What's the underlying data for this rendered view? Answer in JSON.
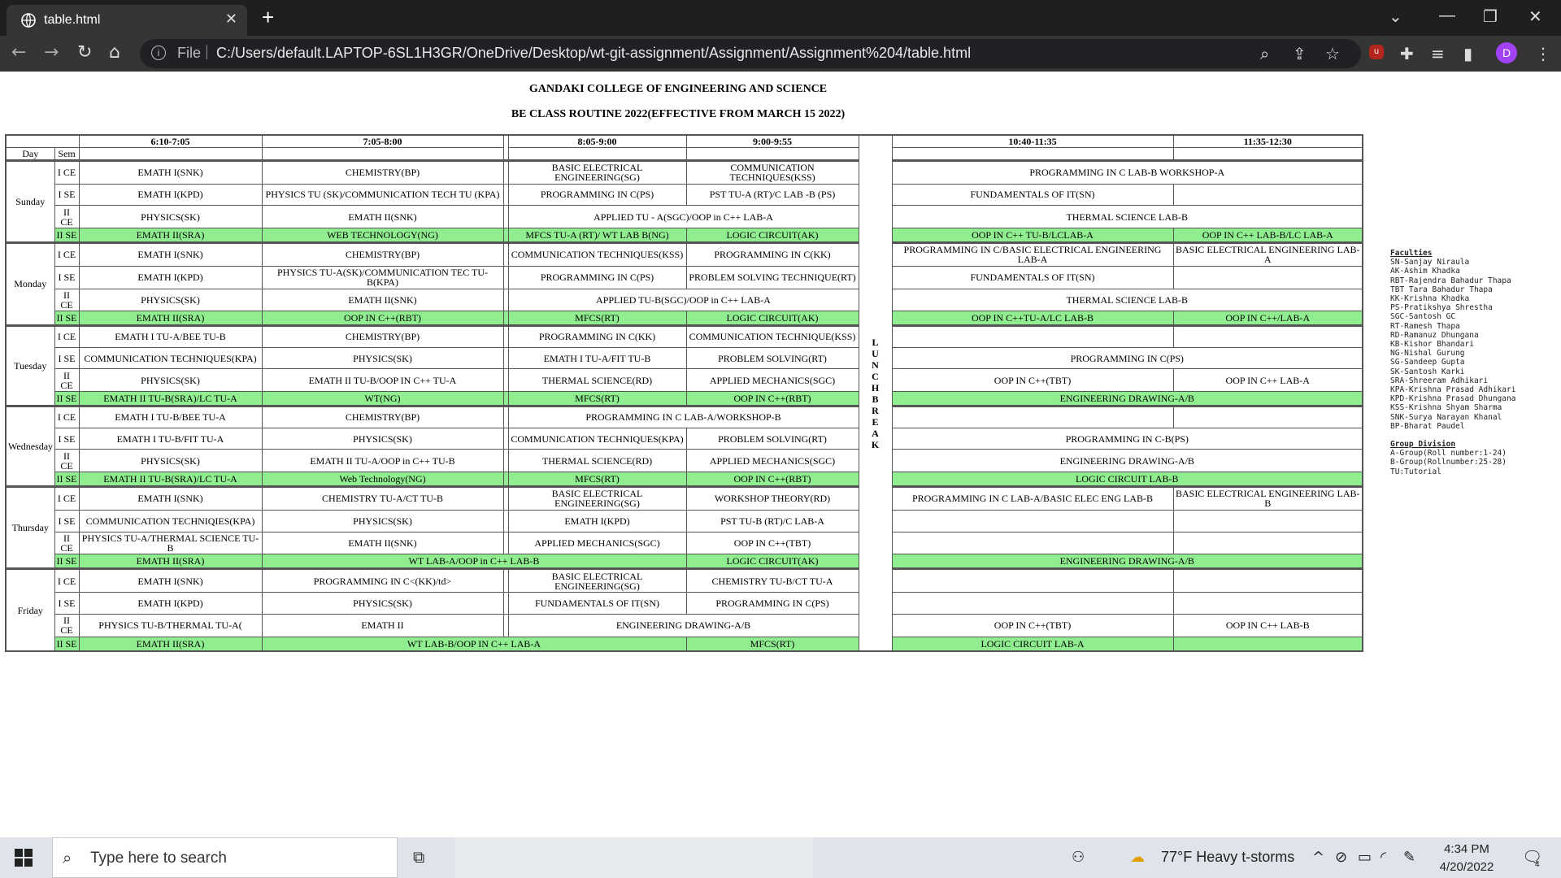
{
  "browser": {
    "tab_title": "table.html",
    "tab_close": "✕",
    "new_tab": "+",
    "file_label": "File",
    "url": "C:/Users/default.LAPTOP-6SL1H3GR/OneDrive/Desktop/wt-git-assignment/Assignment/Assignment%204/table.html",
    "profile_initial": "D"
  },
  "page": {
    "college": "GANDAKI COLLEGE OF ENGINEERING AND SCIENCE",
    "routine_title": "BE CLASS ROUTINE 2022(EFFECTIVE FROM MARCH 15 2022)",
    "table": {
      "times": [
        "6:10-7:05",
        "7:05-8:00",
        "8:05-9:00",
        "9:00-9:55",
        "10:40-11:35",
        "11:35-12:30"
      ],
      "day_header": "Day",
      "sem_header": "Sem",
      "lunch_letters": [
        "L",
        "U",
        "N",
        "C",
        "H",
        "B",
        "R",
        "E",
        "A",
        "K"
      ],
      "days": [
        {
          "name": "Sunday",
          "rows": [
            {
              "sem": "I CE",
              "cells": [
                {
                  "text": "EMATH I(SNK)"
                },
                {
                  "text": "CHEMISTRY(BP)"
                },
                {
                  "text": "BASIC ELECTRICAL ENGINEERING(SG)"
                },
                {
                  "text": "COMMUNICATION TECHNIQUES(KSS)"
                },
                {
                  "text": "PROGRAMMING IN C LAB-B WORKSHOP-A",
                  "span": 2
                }
              ]
            },
            {
              "sem": "I SE",
              "cells": [
                {
                  "text": "EMATH I(KPD)"
                },
                {
                  "text": "PHYSICS TU (SK)/COMMUNICATION TECH TU (KPA)"
                },
                {
                  "text": "PROGRAMMING IN C(PS)"
                },
                {
                  "text": "PST TU-A (RT)/C LAB -B (PS)"
                },
                {
                  "text": "FUNDAMENTALS OF IT(SN)"
                },
                {
                  "text": ""
                }
              ]
            },
            {
              "sem": "II CE",
              "cells": [
                {
                  "text": "PHYSICS(SK)"
                },
                {
                  "text": "EMATH II(SNK)"
                },
                {
                  "text": "APPLIED TU - A(SGC)/OOP in C++ LAB-A",
                  "span": 2
                },
                {
                  "text": "THERMAL SCIENCE LAB-B",
                  "span": 2
                }
              ]
            },
            {
              "sem": "II SE",
              "green": true,
              "cells": [
                {
                  "text": "EMATH II(SRA)"
                },
                {
                  "text": "WEB TECHNOLOGY(NG)"
                },
                {
                  "text": "MFCS TU-A (RT)/ WT LAB B(NG)"
                },
                {
                  "text": "LOGIC CIRCUIT(AK)"
                },
                {
                  "text": "OOP IN C++ TU-B/LCLAB-A"
                },
                {
                  "text": "OOP IN C++ LAB-B/LC LAB-A"
                }
              ]
            }
          ]
        },
        {
          "name": "Monday",
          "rows": [
            {
              "sem": "I CE",
              "cells": [
                {
                  "text": "EMATH I(SNK)"
                },
                {
                  "text": "CHEMISTRY(BP)"
                },
                {
                  "text": "COMMUNICATION TECHNIQUES(KSS)"
                },
                {
                  "text": "PROGRAMMING IN C(KK)"
                },
                {
                  "text": "PROGRAMMING IN C/BASIC ELECTRICAL ENGINEERING LAB-A"
                },
                {
                  "text": "BASIC ELECTRICAL ENGINEERING LAB-A"
                }
              ]
            },
            {
              "sem": "I SE",
              "cells": [
                {
                  "text": "EMATH I(KPD)"
                },
                {
                  "text": "PHYSICS TU-A(SK)/COMMUNICATION TEC TU-B(KPA)"
                },
                {
                  "text": "PROGRAMMING IN C(PS)"
                },
                {
                  "text": "PROBLEM SOLVING TECHNIQUE(RT)"
                },
                {
                  "text": "FUNDAMENTALS OF IT(SN)"
                },
                {
                  "text": ""
                }
              ]
            },
            {
              "sem": "II CE",
              "cells": [
                {
                  "text": "PHYSICS(SK)"
                },
                {
                  "text": "EMATH II(SNK)"
                },
                {
                  "text": "APPLIED TU-B(SGC)/OOP in C++ LAB-A",
                  "span": 2
                },
                {
                  "text": "THERMAL SCIENCE LAB-B",
                  "span": 2
                }
              ]
            },
            {
              "sem": "II SE",
              "green": true,
              "cells": [
                {
                  "text": "EMATH II(SRA)"
                },
                {
                  "text": "OOP IN C++(RBT)"
                },
                {
                  "text": "MFCS(RT)"
                },
                {
                  "text": "LOGIC CIRCUIT(AK)"
                },
                {
                  "text": "OOP IN C++TU-A/LC LAB-B"
                },
                {
                  "text": "OOP IN C++/LAB-A"
                }
              ]
            }
          ]
        },
        {
          "name": "Tuesday",
          "rows": [
            {
              "sem": "I CE",
              "cells": [
                {
                  "text": "EMATH I TU-A/BEE TU-B"
                },
                {
                  "text": "CHEMISTRY(BP)"
                },
                {
                  "text": "PROGRAMMING IN C(KK)"
                },
                {
                  "text": "COMMUNICATION TECHNIQUE(KSS)"
                },
                {
                  "text": ""
                },
                {
                  "text": ""
                }
              ]
            },
            {
              "sem": "I SE",
              "cells": [
                {
                  "text": "COMMUNICATION TECHNIQUES(KPA)"
                },
                {
                  "text": "PHYSICS(SK)"
                },
                {
                  "text": "EMATH I TU-A/FIT TU-B"
                },
                {
                  "text": "PROBLEM SOLVING(RT)"
                },
                {
                  "text": "PROGRAMMING IN C(PS)",
                  "span": 2
                }
              ]
            },
            {
              "sem": "II CE",
              "cells": [
                {
                  "text": "PHYSICS(SK)"
                },
                {
                  "text": "EMATH II TU-B/OOP IN C++ TU-A"
                },
                {
                  "text": "THERMAL SCIENCE(RD)"
                },
                {
                  "text": "APPLIED MECHANICS(SGC)"
                },
                {
                  "text": "OOP IN C++(TBT)"
                },
                {
                  "text": "OOP IN C++ LAB-A"
                }
              ]
            },
            {
              "sem": "II SE",
              "green": true,
              "cells": [
                {
                  "text": "EMATH II TU-B(SRA)/LC TU-A"
                },
                {
                  "text": "WT(NG)"
                },
                {
                  "text": "MFCS(RT)"
                },
                {
                  "text": "OOP IN C++(RBT)"
                },
                {
                  "text": "ENGINEERING DRAWING-A/B",
                  "span": 2
                }
              ]
            }
          ]
        },
        {
          "name": "Wednesday",
          "rows": [
            {
              "sem": "I CE",
              "cells": [
                {
                  "text": "EMATH I TU-B/BEE TU-A"
                },
                {
                  "text": "CHEMISTRY(BP)"
                },
                {
                  "text": "PROGRAMMING IN C LAB-A/WORKSHOP-B",
                  "span": 2
                },
                {
                  "text": ""
                },
                {
                  "text": ""
                }
              ]
            },
            {
              "sem": "I SE",
              "cells": [
                {
                  "text": "EMATH I TU-B/FIT TU-A"
                },
                {
                  "text": "PHYSICS(SK)"
                },
                {
                  "text": "COMMUNICATION TECHNIQUES(KPA)"
                },
                {
                  "text": "PROBLEM SOLVING(RT)"
                },
                {
                  "text": "PROGRAMMING IN C-B(PS)",
                  "span": 2
                }
              ]
            },
            {
              "sem": "II CE",
              "cells": [
                {
                  "text": "PHYSICS(SK)"
                },
                {
                  "text": "EMATH II TU-A/OOP in C++ TU-B"
                },
                {
                  "text": "THERMAL SCIENCE(RD)"
                },
                {
                  "text": "APPLIED MECHANICS(SGC)"
                },
                {
                  "text": "ENGINEERING DRAWING-A/B",
                  "span": 2
                }
              ]
            },
            {
              "sem": "II SE",
              "green": true,
              "cells": [
                {
                  "text": "EMATH II TU-B(SRA)/LC TU-A"
                },
                {
                  "text": "Web Technology(NG)"
                },
                {
                  "text": "MFCS(RT)"
                },
                {
                  "text": "OOP IN C++(RBT)"
                },
                {
                  "text": "LOGIC CIRCUIT LAB-B",
                  "span": 2
                }
              ]
            }
          ]
        },
        {
          "name": "Thursday",
          "rows": [
            {
              "sem": "I CE",
              "cells": [
                {
                  "text": "EMATH I(SNK)"
                },
                {
                  "text": "CHEMISTRY TU-A/CT TU-B"
                },
                {
                  "text": "BASIC ELECTRICAL ENGINEERING(SG)"
                },
                {
                  "text": "WORKSHOP THEORY(RD)"
                },
                {
                  "text": "PROGRAMMING IN C LAB-A/BASIC ELEC ENG LAB-B"
                },
                {
                  "text": "BASIC ELECTRICAL ENGINEERING LAB-B"
                }
              ]
            },
            {
              "sem": "I SE",
              "cells": [
                {
                  "text": "COMMUNICATION TECHNIQIES(KPA)"
                },
                {
                  "text": "PHYSICS(SK)"
                },
                {
                  "text": "EMATH I(KPD)"
                },
                {
                  "text": "PST TU-B (RT)/C LAB-A"
                },
                {
                  "text": ""
                },
                {
                  "text": ""
                }
              ]
            },
            {
              "sem": "II CE",
              "cells": [
                {
                  "text": "PHYSICS TU-A/THERMAL SCIENCE TU-B"
                },
                {
                  "text": "EMATH II(SNK)"
                },
                {
                  "text": "APPLIED MECHANICS(SGC)"
                },
                {
                  "text": "OOP IN C++(TBT)"
                },
                {
                  "text": ""
                },
                {
                  "text": ""
                }
              ]
            },
            {
              "sem": "II SE",
              "green": true,
              "cells": [
                {
                  "text": "EMATH II(SRA)"
                },
                {
                  "text": "WT LAB-A/OOP in C++ LAB-B",
                  "span": 2
                },
                {
                  "text": "LOGIC CIRCUIT(AK)"
                },
                {
                  "text": "ENGINEERING DRAWING-A/B",
                  "span": 2
                }
              ]
            }
          ]
        },
        {
          "name": "Friday",
          "rows": [
            {
              "sem": "I CE",
              "cells": [
                {
                  "text": "EMATH I(SNK)"
                },
                {
                  "text": "PROGRAMMING IN C<(KK)/td>"
                },
                {
                  "text": "BASIC ELECTRICAL ENGINEERING(SG)"
                },
                {
                  "text": "CHEMISTRY TU-B/CT TU-A"
                },
                {
                  "text": ""
                },
                {
                  "text": ""
                }
              ]
            },
            {
              "sem": "I SE",
              "cells": [
                {
                  "text": "EMATH I(KPD)"
                },
                {
                  "text": "PHYSICS(SK)"
                },
                {
                  "text": "FUNDAMENTALS OF IT(SN)"
                },
                {
                  "text": "PROGRAMMING IN C(PS)"
                },
                {
                  "text": ""
                },
                {
                  "text": ""
                }
              ]
            },
            {
              "sem": "II CE",
              "cells": [
                {
                  "text": "PHYSICS TU-B/THERMAL TU-A("
                },
                {
                  "text": "EMATH II"
                },
                {
                  "text": "ENGINEERING DRAWING-A/B",
                  "span": 2
                },
                {
                  "text": "OOP IN C++(TBT)"
                },
                {
                  "text": "OOP IN C++ LAB-B"
                }
              ]
            },
            {
              "sem": "II SE",
              "green": true,
              "cells": [
                {
                  "text": "EMATH II(SRA)"
                },
                {
                  "text": "WT LAB-B/OOP IN C++ LAB-A",
                  "span": 2
                },
                {
                  "text": "MFCS(RT)"
                },
                {
                  "text": "LOGIC CIRCUIT LAB-A"
                },
                {
                  "text": ""
                }
              ]
            }
          ]
        }
      ]
    },
    "faculties_title": "Faculties",
    "faculties": [
      "SN-Sanjay Niraula",
      "AK-Ashim Khadka",
      "RBT-Rajendra Bahadur Thapa",
      "TBT Tara Bahadur Thapa",
      "KK-Krishna Khadka",
      "PS-Pratikshya Shrestha",
      "SGC-Santosh GC",
      "RT-Ramesh Thapa",
      "RD-Ramanuz Dhungana",
      "KB-Kishor Bhandari",
      "NG-Nishal Gurung",
      "SG-Sandeep Gupta",
      "SK-Santosh Karki",
      "SRA-Shreeram Adhikari",
      "KPA-Krishna Prasad Adhikari",
      "KPD-Krishna Prasad Dhungana",
      "KSS-Krishna Shyam Sharma",
      "SNK-Surya Narayan Khanal",
      "BP-Bharat Paudel"
    ],
    "groups_title": "Group Division",
    "groups": [
      "A-Group(Roll number:1-24)",
      "B-Group(Rollnumber:25-28)",
      "TU:Tutorial"
    ]
  },
  "taskbar": {
    "search_placeholder": "Type here to search",
    "weather": "77°F  Heavy t-storms",
    "time": "4:34 PM",
    "date": "4/20/2022",
    "notification_count": "4"
  },
  "colors": {
    "lab_row_green": "#90ee90",
    "chrome_dark": "#1f1f1f",
    "chrome_toolbar": "#353535",
    "profile": "#a142f4"
  }
}
